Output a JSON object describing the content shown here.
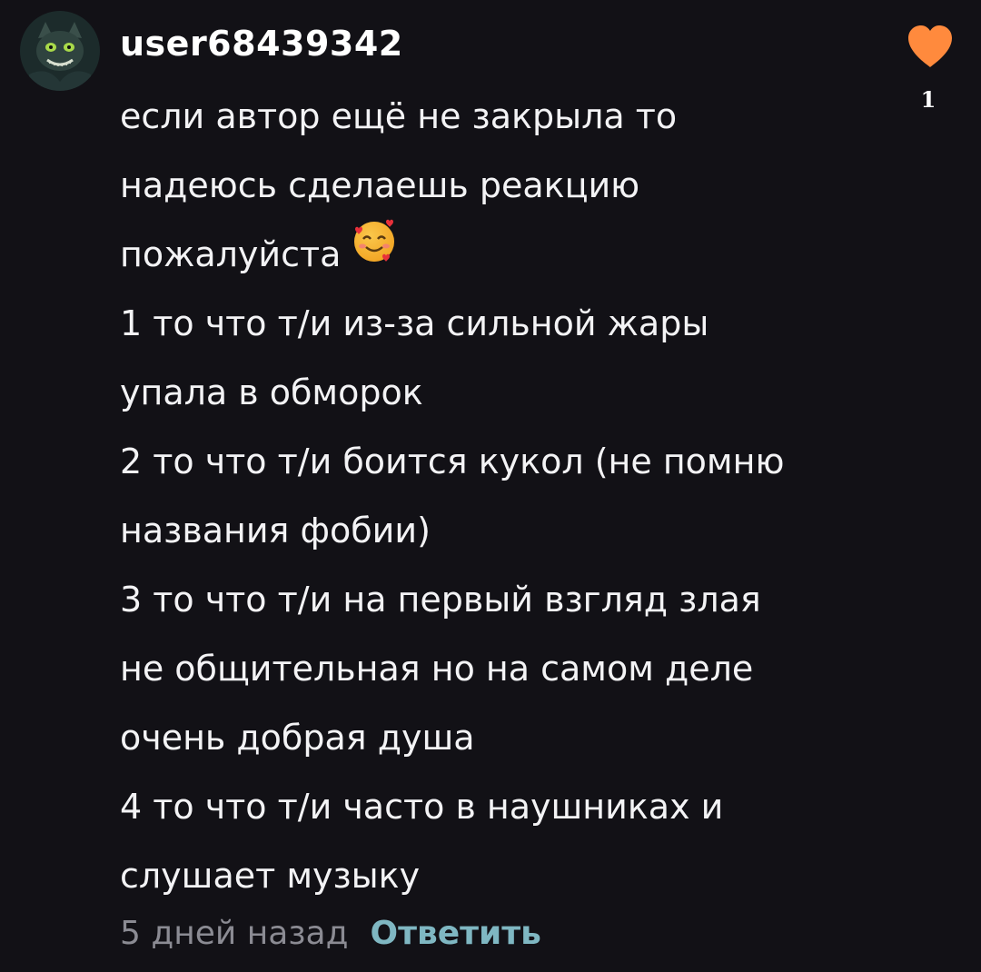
{
  "comment": {
    "username": "user68439342",
    "lines": [
      "если автор ещё не закрыла то",
      "надеюсь сделаешь реакцию",
      "пожалуйста",
      "1 то что т/и из-за сильной жары",
      "упала в обморок",
      "2 то что т/и боится кукол (не помню",
      "названия фобии)",
      "3 то что т/и на первый взгляд злая",
      "не общительная но на самом деле",
      "очень добрая душа",
      "4 то что т/и часто в наушниках и",
      "слушает музыку"
    ],
    "emoji": "smiling-face-with-hearts-icon",
    "like_count": "1",
    "timestamp": "5 дней назад",
    "reply_label": "Ответить"
  },
  "colors": {
    "background": "#121116",
    "heart": "#ff8a3d",
    "reply": "#7fb7c2",
    "timestamp": "#8b8b93"
  }
}
